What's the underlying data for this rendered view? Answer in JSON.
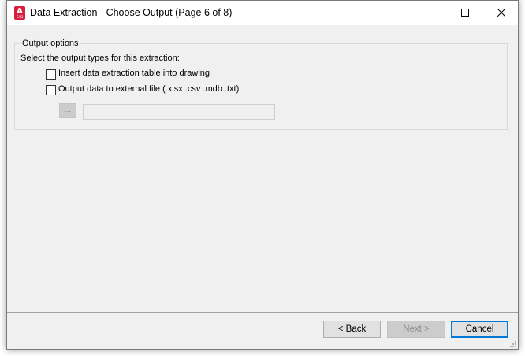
{
  "window": {
    "title": "Data Extraction - Choose Output (Page 6 of 8)",
    "app_icon_letter": "A",
    "app_icon_sub": "CAD"
  },
  "output_options": {
    "legend": "Output options",
    "instruction": "Select the output types for this extraction:",
    "insert_table_label": "Insert data extraction table into drawing",
    "insert_table_checked": false,
    "external_file_label": "Output data to external file (.xlsx .csv .mdb .txt)",
    "external_file_checked": false,
    "browse_label": "...",
    "file_path_value": ""
  },
  "footer": {
    "back_label": "< Back",
    "next_label": "Next >",
    "cancel_label": "Cancel"
  },
  "colors": {
    "dialog_bg": "#f0f0f0",
    "titlebar_bg": "#ffffff",
    "accent": "#0078d7",
    "app_icon": "#d6203d"
  }
}
